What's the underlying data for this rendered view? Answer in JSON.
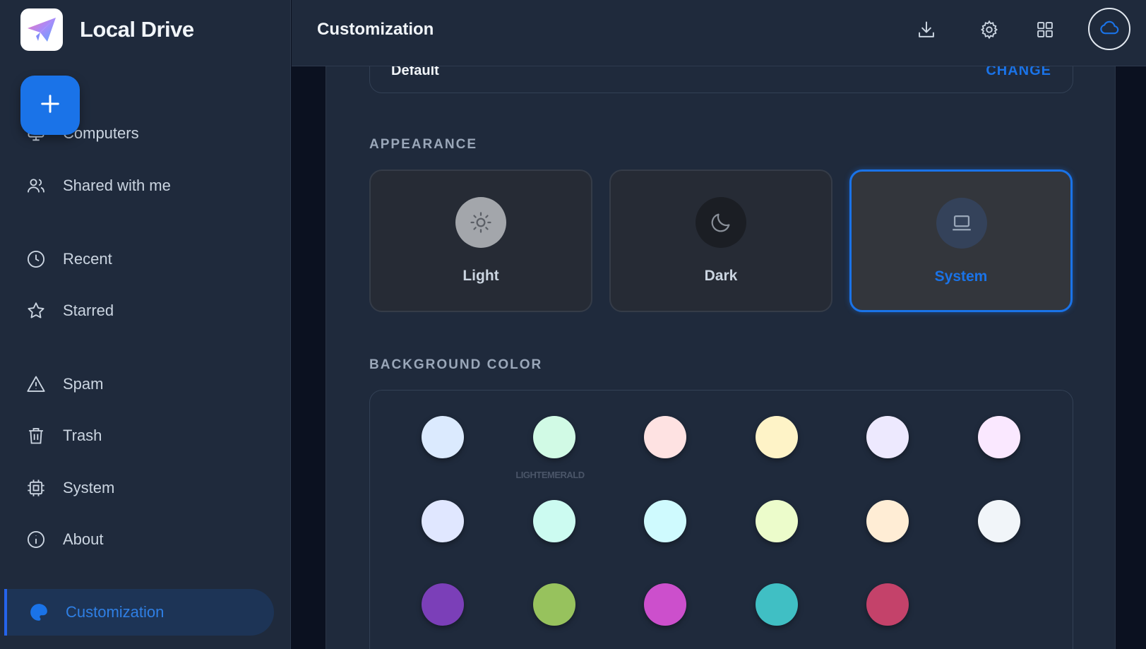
{
  "app": {
    "name": "Local Drive"
  },
  "sidebar": {
    "new_button_icon": "plus-icon",
    "items": [
      {
        "label": "Computers",
        "icon": "monitor-icon"
      },
      {
        "label": "Shared with me",
        "icon": "users-icon"
      },
      {
        "label": "Recent",
        "icon": "clock-icon"
      },
      {
        "label": "Starred",
        "icon": "star-icon"
      },
      {
        "label": "Spam",
        "icon": "warning-icon"
      },
      {
        "label": "Trash",
        "icon": "trash-icon"
      },
      {
        "label": "System",
        "icon": "chip-icon"
      },
      {
        "label": "About",
        "icon": "info-icon"
      },
      {
        "label": "Customization",
        "icon": "palette-icon",
        "active": true
      }
    ]
  },
  "header": {
    "title": "Customization",
    "actions": [
      "download-icon",
      "gear-icon",
      "grid-icon",
      "cloud-icon"
    ]
  },
  "font": {
    "value": "Default",
    "action": "CHANGE"
  },
  "appearance": {
    "label": "APPEARANCE",
    "options": [
      {
        "label": "Light",
        "icon": "sun-icon"
      },
      {
        "label": "Dark",
        "icon": "moon-icon"
      },
      {
        "label": "System",
        "icon": "laptop-icon",
        "selected": true
      }
    ]
  },
  "background_color": {
    "label": "BACKGROUND COLOR",
    "hover_caption": "LIGHTEMERALD",
    "swatches": [
      "#dbeafe",
      "#d1fae5",
      "#fee2e2",
      "#fef3c7",
      "#ede9fe",
      "#fae8ff",
      "#e0e7ff",
      "#ccfbf1",
      "#cffafe",
      "#ecfccb",
      "#ffedd5",
      "#f1f5f9",
      "#7b3fb8",
      "#97c25d",
      "#cc4fcc",
      "#40bfc4",
      "#c4426a"
    ]
  },
  "colors": {
    "accent": "#1a73e8",
    "sidebar_bg": "#1f2a3c",
    "page_bg": "#0b1120"
  }
}
